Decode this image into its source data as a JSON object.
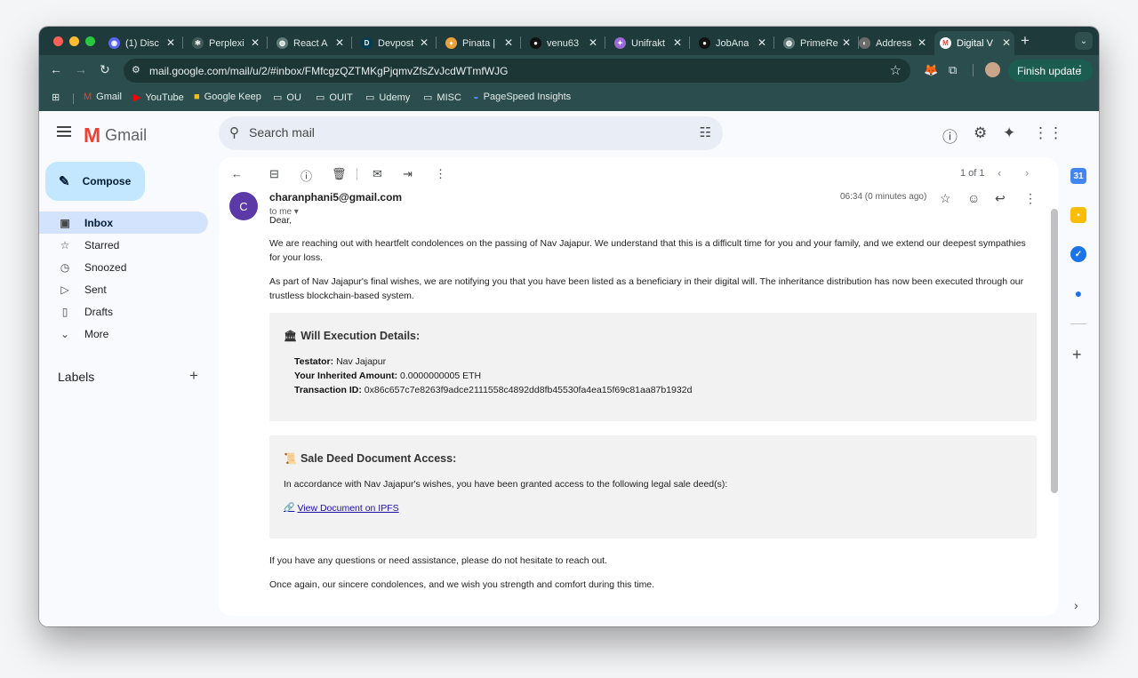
{
  "browser": {
    "tabs": [
      {
        "title": "(1) Disc",
        "favicon": "discord-icon",
        "color": "#5865f2"
      },
      {
        "title": "Perplexi",
        "favicon": "perplexity-icon",
        "color": "#3f5a5a"
      },
      {
        "title": "React A",
        "favicon": "globe-icon",
        "color": "#5f7a7a"
      },
      {
        "title": "Devpost",
        "favicon": "devpost-icon",
        "color": "#003e54",
        "letter": "D"
      },
      {
        "title": "Pinata |",
        "favicon": "pinata-icon",
        "color": "#e9a23b"
      },
      {
        "title": "venu63",
        "favicon": "github-icon",
        "color": "#111111"
      },
      {
        "title": "Unifrakt",
        "favicon": "unifrakt-icon",
        "color": "#9c6ad6"
      },
      {
        "title": "JobAna",
        "favicon": "github-icon",
        "color": "#111111"
      },
      {
        "title": "PrimeRe",
        "favicon": "globe-icon",
        "color": "#5f7a7a"
      },
      {
        "title": "Address",
        "favicon": "address-icon",
        "color": "#6b6b6b"
      },
      {
        "title": "Digital V",
        "favicon": "gmail-icon",
        "color": "#ea4335",
        "active": true
      }
    ],
    "new_tab_label": "+",
    "url": "mail.google.com/mail/u/2/#inbox/FMfcgzQZTMKgPjqmvZfsZvJcdWTmfWJG",
    "finish_update_label": "Finish update",
    "bookmarks": [
      {
        "label": "Gmail",
        "icon": "gmail-icon"
      },
      {
        "label": "YouTube",
        "icon": "youtube-icon"
      },
      {
        "label": "Google Keep",
        "icon": "keep-icon"
      },
      {
        "label": "OU",
        "icon": "folder-icon"
      },
      {
        "label": "OUIT",
        "icon": "folder-icon"
      },
      {
        "label": "Udemy",
        "icon": "folder-icon"
      },
      {
        "label": "MISC",
        "icon": "folder-icon"
      },
      {
        "label": "PageSpeed Insights",
        "icon": "pagespeed-icon"
      }
    ]
  },
  "gmail": {
    "brand": "Gmail",
    "search_placeholder": "Search mail",
    "compose_label": "Compose",
    "nav": [
      {
        "label": "Inbox",
        "icon": "inbox-icon",
        "active": true
      },
      {
        "label": "Starred",
        "icon": "star-icon"
      },
      {
        "label": "Snoozed",
        "icon": "clock-icon"
      },
      {
        "label": "Sent",
        "icon": "send-icon"
      },
      {
        "label": "Drafts",
        "icon": "draft-icon"
      },
      {
        "label": "More",
        "icon": "chevron-down-icon"
      }
    ],
    "labels_heading": "Labels",
    "counter": "1 of 1"
  },
  "email": {
    "sender": "charanphani5@gmail.com",
    "avatar_letter": "C",
    "avatar_color": "#5b39a6",
    "to": "to me",
    "time": "06:34 (0 minutes ago)",
    "greeting": "Dear,",
    "paragraph1": "We are reaching out with heartfelt condolences on the passing of Nav Jajapur. We understand that this is a difficult time for you and your family, and we extend our deepest sympathies for your loss.",
    "paragraph2": "As part of Nav Jajapur's final wishes, we are notifying you that you have been listed as a beneficiary in their digital will. The inheritance distribution has now been executed through our trustless blockchain-based system.",
    "will_title": "Will Execution Details:",
    "testator_label": "Testator:",
    "testator_value": "Nav Jajapur",
    "amount_label": "Your Inherited Amount:",
    "amount_value": "0.0000000005 ETH",
    "txid_label": "Transaction ID:",
    "txid_value": "0x86c657c7e8263f9adce2111558c4892dd8fb45530fa4ea15f69c81aa87b1932d",
    "deed_title": "Sale Deed Document Access:",
    "deed_text": "In accordance with Nav Jajapur's wishes, you have been granted access to the following legal sale deed(s):",
    "ipfs_link": "View Document on IPFS",
    "closing1": "If you have any questions or need assistance, please do not hesitate to reach out.",
    "closing2": "Once again, our sincere condolences, and we wish you strength and comfort during this time."
  }
}
